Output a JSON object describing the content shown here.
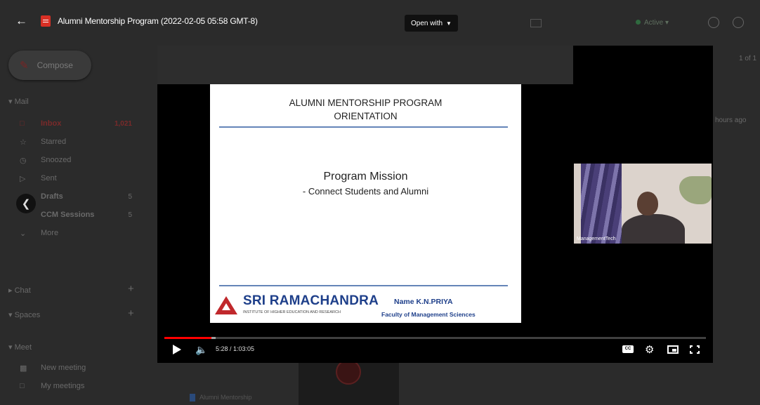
{
  "viewer": {
    "file_title": "Alumni Mentorship Program (2022-02-05 05:58 GMT-8)",
    "open_with_label": "Open with"
  },
  "player": {
    "current_time": "5:28",
    "duration": "1:03:05",
    "time_display": "5:28 / 1:03:05",
    "progress_fraction": 0.087,
    "buffered_fraction": 0.095,
    "cc_label": "CC",
    "participant_label": "ManagementTech"
  },
  "slide": {
    "title_line1": "ALUMNI MENTORSHIP PROGRAM",
    "title_line2": "ORIENTATION",
    "mission_heading": "Program Mission",
    "mission_text": "- Connect Students and Alumni",
    "institution_name": "SRI RAMACHANDRA",
    "institution_tagline": "INSTITUTE OF HIGHER EDUCATION AND RESEARCH",
    "presenter_name": "Name K.N.PRIYA",
    "presenter_faculty": "Faculty of Management Sciences"
  },
  "background_app": {
    "compose_label": "Compose",
    "mail_header": "Mail",
    "folders": [
      {
        "label": "Inbox",
        "count": "1,021"
      },
      {
        "label": "Starred",
        "count": ""
      },
      {
        "label": "Snoozed",
        "count": ""
      },
      {
        "label": "Sent",
        "count": ""
      },
      {
        "label": "Drafts",
        "count": "5"
      },
      {
        "label": "CCM Sessions",
        "count": "5"
      },
      {
        "label": "More",
        "count": ""
      }
    ],
    "chat_header": "Chat",
    "spaces_header": "Spaces",
    "meet_header": "Meet",
    "meet_items": [
      "New meeting",
      "My meetings"
    ],
    "status_label": "Active",
    "pagination": "1 of 1",
    "time_ago": "hours ago",
    "attachment_label": "Alumni Mentorship"
  },
  "colors": {
    "progress_red": "#ff0000",
    "slide_rule_blue": "#6585b8",
    "institution_blue": "#1e3f8a",
    "logo_red": "#c0282c"
  }
}
